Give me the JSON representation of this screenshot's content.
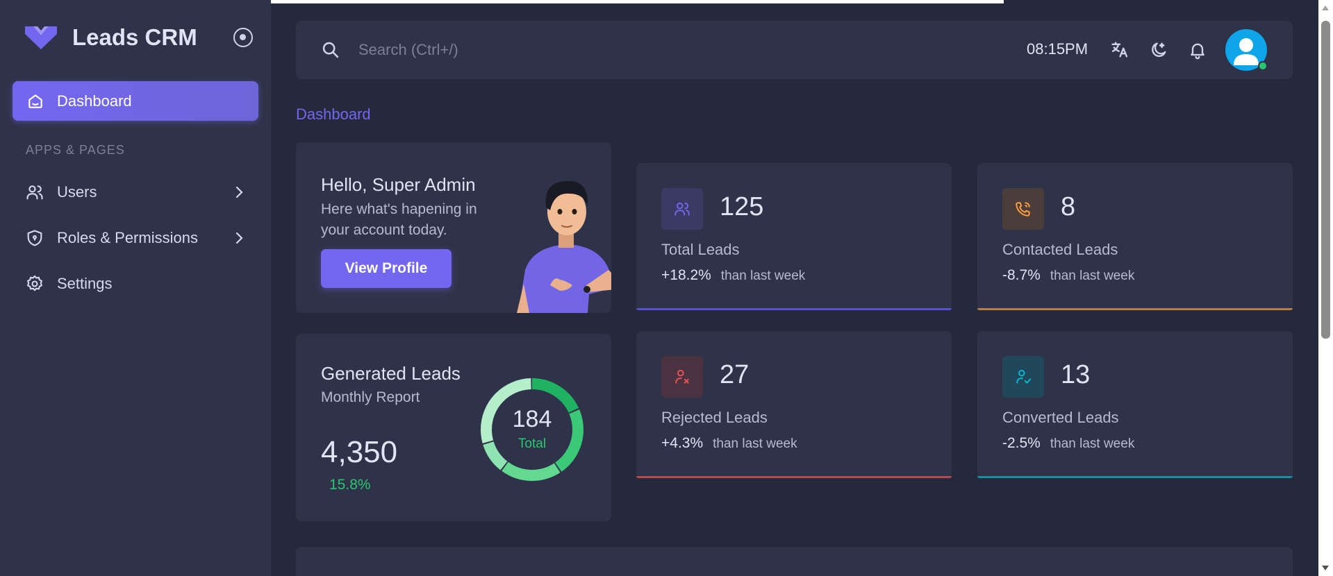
{
  "app": {
    "name": "Leads CRM"
  },
  "sidebar": {
    "active_item": "Dashboard",
    "section_heading": "APPS & PAGES",
    "items": [
      {
        "label": "Users",
        "icon": "users-icon",
        "has_submenu": true
      },
      {
        "label": "Roles & Permissions",
        "icon": "shield-icon",
        "has_submenu": true
      },
      {
        "label": "Settings",
        "icon": "gear-icon",
        "has_submenu": false
      }
    ]
  },
  "topbar": {
    "search_placeholder": "Search (Ctrl+/)",
    "time": "08:15PM",
    "icons": [
      "translate-icon",
      "theme-toggle-icon",
      "bell-icon",
      "avatar"
    ]
  },
  "breadcrumb": "Dashboard",
  "welcome": {
    "title": "Hello, Super Admin",
    "subtitle": "Here what's hapening in your account today.",
    "button": "View Profile"
  },
  "stats": [
    {
      "value": "125",
      "label": "Total Leads",
      "change": "+18.2%",
      "note": "than last week",
      "color": "#7367f0"
    },
    {
      "value": "8",
      "label": "Contacted Leads",
      "change": "-8.7%",
      "note": "than last week",
      "color": "#ff9f43"
    },
    {
      "value": "27",
      "label": "Rejected Leads",
      "change": "+4.3%",
      "note": "than last week",
      "color": "#ea5455"
    },
    {
      "value": "13",
      "label": "Converted Leads",
      "change": "-2.5%",
      "note": "than last week",
      "color": "#00bad1"
    }
  ],
  "generated": {
    "title": "Generated Leads",
    "subtitle": "Monthly Report",
    "value": "4,350",
    "growth": "15.8%",
    "donut_total": "184",
    "donut_label": "Total"
  },
  "colors": {
    "primary": "#7367f0",
    "success": "#28c76f",
    "background": "#25293c",
    "card": "#2f3349"
  }
}
